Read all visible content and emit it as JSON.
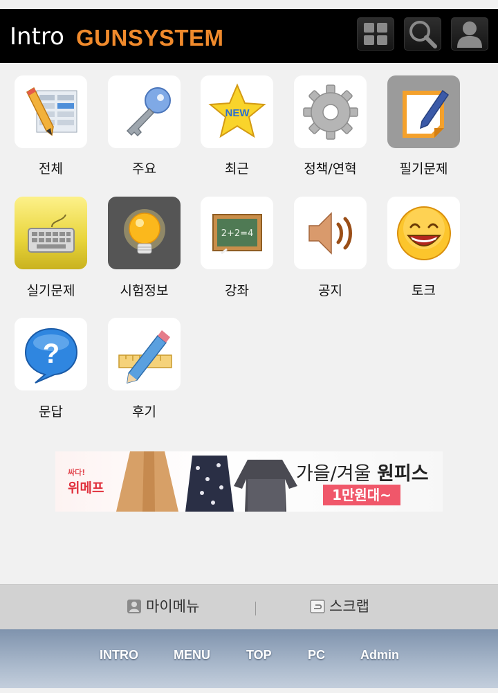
{
  "header": {
    "title": "Intro",
    "brand": "GUNSYSTEM",
    "buttons": [
      {
        "icon": "grid-icon"
      },
      {
        "icon": "search-icon"
      },
      {
        "icon": "user-icon"
      }
    ]
  },
  "menu": {
    "items": [
      {
        "label": "전체",
        "icon": "list-pencil-icon"
      },
      {
        "label": "주요",
        "icon": "key-icon"
      },
      {
        "label": "최근",
        "icon": "new-star-icon"
      },
      {
        "label": "정책/연혁",
        "icon": "gear-icon"
      },
      {
        "label": "필기문제",
        "icon": "note-pen-icon"
      },
      {
        "label": "실기문제",
        "icon": "keyboard-icon"
      },
      {
        "label": "시험정보",
        "icon": "lightbulb-icon"
      },
      {
        "label": "강좌",
        "icon": "chalkboard-icon"
      },
      {
        "label": "공지",
        "icon": "speaker-icon"
      },
      {
        "label": "토크",
        "icon": "smiley-icon"
      },
      {
        "label": "문답",
        "icon": "question-bubble-icon"
      },
      {
        "label": "후기",
        "icon": "pencil-ruler-icon"
      }
    ]
  },
  "ad": {
    "logo_top": "싸다!",
    "logo": "위메프",
    "headline_plain": "가을/겨울 ",
    "headline_bold": "원피스",
    "price": "1만원대~"
  },
  "mymenu": {
    "my_menu": "마이메뉴",
    "scrap": "스크랩"
  },
  "nav": {
    "links": [
      "INTRO",
      "MENU",
      "TOP",
      "PC",
      "Admin"
    ]
  },
  "colors": {
    "header_bg": "#000000",
    "brand": "#f08a2c",
    "page_bg": "#f1f1f1",
    "nav_gradient_top": "#7f93ad",
    "nav_gradient_bottom": "#c3cedc"
  }
}
